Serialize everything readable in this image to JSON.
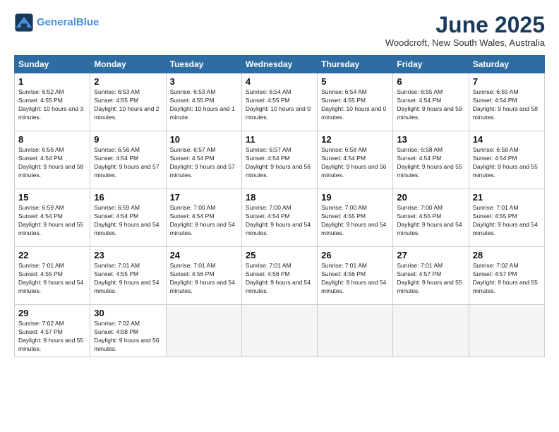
{
  "logo": {
    "line1": "General",
    "line2": "Blue"
  },
  "title": "June 2025",
  "location": "Woodcroft, New South Wales, Australia",
  "days_header": [
    "Sunday",
    "Monday",
    "Tuesday",
    "Wednesday",
    "Thursday",
    "Friday",
    "Saturday"
  ],
  "weeks": [
    [
      {
        "day": 1,
        "rise": "6:52 AM",
        "set": "4:55 PM",
        "daylight": "10 hours and 3 minutes."
      },
      {
        "day": 2,
        "rise": "6:53 AM",
        "set": "4:55 PM",
        "daylight": "10 hours and 2 minutes."
      },
      {
        "day": 3,
        "rise": "6:53 AM",
        "set": "4:55 PM",
        "daylight": "10 hours and 1 minute."
      },
      {
        "day": 4,
        "rise": "6:54 AM",
        "set": "4:55 PM",
        "daylight": "10 hours and 0 minutes."
      },
      {
        "day": 5,
        "rise": "6:54 AM",
        "set": "4:55 PM",
        "daylight": "10 hours and 0 minutes."
      },
      {
        "day": 6,
        "rise": "6:55 AM",
        "set": "4:54 PM",
        "daylight": "9 hours and 59 minutes."
      },
      {
        "day": 7,
        "rise": "6:55 AM",
        "set": "4:54 PM",
        "daylight": "9 hours and 58 minutes."
      }
    ],
    [
      {
        "day": 8,
        "rise": "6:56 AM",
        "set": "4:54 PM",
        "daylight": "9 hours and 58 minutes."
      },
      {
        "day": 9,
        "rise": "6:56 AM",
        "set": "4:54 PM",
        "daylight": "9 hours and 57 minutes."
      },
      {
        "day": 10,
        "rise": "6:57 AM",
        "set": "4:54 PM",
        "daylight": "9 hours and 57 minutes."
      },
      {
        "day": 11,
        "rise": "6:57 AM",
        "set": "4:54 PM",
        "daylight": "9 hours and 56 minutes."
      },
      {
        "day": 12,
        "rise": "6:58 AM",
        "set": "4:54 PM",
        "daylight": "9 hours and 56 minutes."
      },
      {
        "day": 13,
        "rise": "6:58 AM",
        "set": "4:54 PM",
        "daylight": "9 hours and 55 minutes."
      },
      {
        "day": 14,
        "rise": "6:58 AM",
        "set": "4:54 PM",
        "daylight": "9 hours and 55 minutes."
      }
    ],
    [
      {
        "day": 15,
        "rise": "6:59 AM",
        "set": "4:54 PM",
        "daylight": "9 hours and 55 minutes."
      },
      {
        "day": 16,
        "rise": "6:59 AM",
        "set": "4:54 PM",
        "daylight": "9 hours and 54 minutes."
      },
      {
        "day": 17,
        "rise": "7:00 AM",
        "set": "4:54 PM",
        "daylight": "9 hours and 54 minutes."
      },
      {
        "day": 18,
        "rise": "7:00 AM",
        "set": "4:54 PM",
        "daylight": "9 hours and 54 minutes."
      },
      {
        "day": 19,
        "rise": "7:00 AM",
        "set": "4:55 PM",
        "daylight": "9 hours and 54 minutes."
      },
      {
        "day": 20,
        "rise": "7:00 AM",
        "set": "4:55 PM",
        "daylight": "9 hours and 54 minutes."
      },
      {
        "day": 21,
        "rise": "7:01 AM",
        "set": "4:55 PM",
        "daylight": "9 hours and 54 minutes."
      }
    ],
    [
      {
        "day": 22,
        "rise": "7:01 AM",
        "set": "4:55 PM",
        "daylight": "9 hours and 54 minutes."
      },
      {
        "day": 23,
        "rise": "7:01 AM",
        "set": "4:55 PM",
        "daylight": "9 hours and 54 minutes."
      },
      {
        "day": 24,
        "rise": "7:01 AM",
        "set": "4:56 PM",
        "daylight": "9 hours and 54 minutes."
      },
      {
        "day": 25,
        "rise": "7:01 AM",
        "set": "4:56 PM",
        "daylight": "9 hours and 54 minutes."
      },
      {
        "day": 26,
        "rise": "7:01 AM",
        "set": "4:56 PM",
        "daylight": "9 hours and 54 minutes."
      },
      {
        "day": 27,
        "rise": "7:01 AM",
        "set": "4:57 PM",
        "daylight": "9 hours and 55 minutes."
      },
      {
        "day": 28,
        "rise": "7:02 AM",
        "set": "4:57 PM",
        "daylight": "9 hours and 55 minutes."
      }
    ],
    [
      {
        "day": 29,
        "rise": "7:02 AM",
        "set": "4:57 PM",
        "daylight": "9 hours and 55 minutes."
      },
      {
        "day": 30,
        "rise": "7:02 AM",
        "set": "4:58 PM",
        "daylight": "9 hours and 56 minutes."
      },
      null,
      null,
      null,
      null,
      null
    ]
  ]
}
